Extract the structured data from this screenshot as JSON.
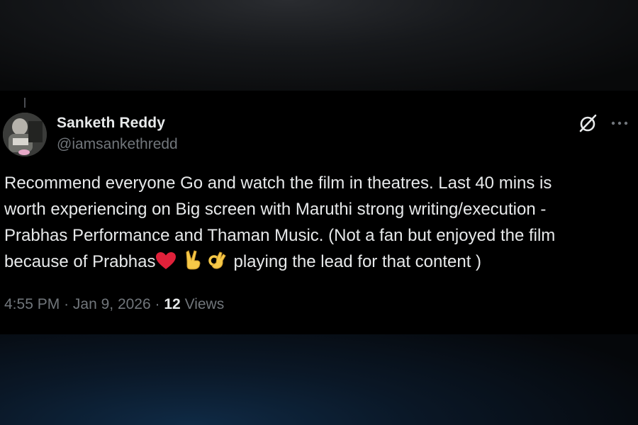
{
  "author": {
    "display_name": "Sanketh Reddy",
    "handle": "@iamsankethredd"
  },
  "tweet": {
    "line_1": "Recommend everyone Go and watch the film in theatres. Last 40 mins is",
    "line_2": "worth experiencing on Big screen with Maruthi strong writing/execution -",
    "line_3": "Prabhas Performance and Thaman Music. (Not a fan but enjoyed the film",
    "line_4_start": "because of Prabhas",
    "line_4_end": "playing the lead for that content )",
    "emojis": [
      "red-heart-icon",
      "victory-hand-icon",
      "ok-hand-icon"
    ]
  },
  "meta": {
    "time": "4:55 PM",
    "separator": "·",
    "date": "Jan 9, 2026",
    "views_count": "12",
    "views_label": "Views"
  },
  "colors": {
    "background": "#000000",
    "primary_text": "#e7e9ea",
    "secondary_text": "#71767b"
  },
  "icons": {
    "grok": "grok-icon",
    "more": "more-dots-icon"
  }
}
